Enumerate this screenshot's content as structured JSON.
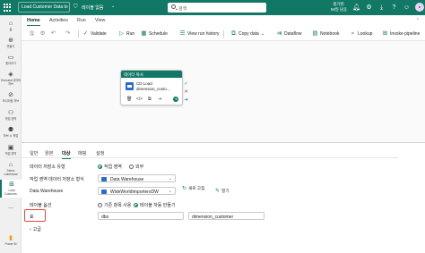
{
  "header": {
    "title": "Load Customer Data to DW",
    "workspace_label": "레이블 없음",
    "search_placeholder": "검색",
    "trial_line1": "평가판:",
    "trial_line2": "59일 남음"
  },
  "left_rail": {
    "items": [
      {
        "label": "홈"
      },
      {
        "label": "만들기"
      },
      {
        "label": "찾아보기"
      },
      {
        "label": "OneLake 데이터 허브"
      },
      {
        "label": "모니터링 허브"
      },
      {
        "label": "작업 영역"
      },
      {
        "label": "하브 시 작업"
      },
      {
        "label": "작업 영역"
      },
      {
        "label": "Fabric Lakehouse"
      },
      {
        "label": "Load Customer..."
      },
      {
        "label": "..."
      },
      {
        "label": "Power BI"
      }
    ]
  },
  "ribbon": {
    "tabs": [
      {
        "label": "Home",
        "active": true
      },
      {
        "label": "Activities",
        "active": false
      },
      {
        "label": "Run",
        "active": false
      },
      {
        "label": "View",
        "active": false
      }
    ],
    "toolbar": {
      "validate": "Validate",
      "run": "Run",
      "schedule": "Schedule",
      "view_run_history": "View run history",
      "copy_data": "Copy data",
      "dataflow": "Dataflow",
      "notebook": "Notebook",
      "lookup": "Lookup",
      "invoke_pipeline": "Invoke pipeline"
    }
  },
  "canvas": {
    "activity": {
      "type_label": "데이터 복사",
      "name_line1": "CD Load",
      "name_line2": "dimension_custo..."
    }
  },
  "properties": {
    "tabs": [
      {
        "label": "일반",
        "active": false
      },
      {
        "label": "원본",
        "active": false
      },
      {
        "label": "대상",
        "active": true
      },
      {
        "label": "매핑",
        "active": false
      },
      {
        "label": "설정",
        "active": false
      }
    ],
    "store_type": {
      "label": "데이터 저장소 유형",
      "options": [
        "작업 영역",
        "외부"
      ],
      "selected": "작업 영역"
    },
    "workspace_store_type": {
      "label": "작업 영역 데이터 저장소 형식",
      "value": "Data Warehouse"
    },
    "data_warehouse": {
      "label": "Data Warehouse",
      "value": "WideWorldImportersDW",
      "refresh": "새로 고침",
      "open": "열기"
    },
    "table_option": {
      "label": "테이블 옵션",
      "options": [
        "기존 항목 사용",
        "테이블 자동 만들기"
      ],
      "selected": "테이블 자동 만들기"
    },
    "table": {
      "label": "표",
      "schema": "dbo",
      "name": "dimension_customer"
    },
    "advanced": "고급"
  }
}
